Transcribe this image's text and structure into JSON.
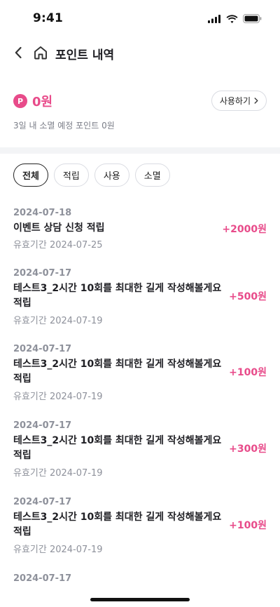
{
  "status_bar": {
    "time": "9:41"
  },
  "header": {
    "title": "포인트 내역"
  },
  "summary": {
    "badge": "P",
    "value": "0원",
    "use_button": "사용하기",
    "expire_note": "3일 내 소멸 예정 포인트 0원"
  },
  "filters": [
    {
      "label": "전체",
      "active": true
    },
    {
      "label": "적립",
      "active": false
    },
    {
      "label": "사용",
      "active": false
    },
    {
      "label": "소멸",
      "active": false
    }
  ],
  "history": [
    {
      "date": "2024-07-18",
      "title": "이벤트 상담 신청 적립",
      "expiry": "유효기간 2024-07-25",
      "amount": "+2000원"
    },
    {
      "date": "2024-07-17",
      "title": "테스트3_2시간 10회를 최대한 길게 작성해볼게요 적립",
      "expiry": "유효기간 2024-07-19",
      "amount": "+500원"
    },
    {
      "date": "2024-07-17",
      "title": "테스트3_2시간 10회를 최대한 길게 작성해볼게요 적립",
      "expiry": "유효기간 2024-07-19",
      "amount": "+100원"
    },
    {
      "date": "2024-07-17",
      "title": "테스트3_2시간 10회를 최대한 길게 작성해볼게요 적립",
      "expiry": "유효기간 2024-07-19",
      "amount": "+300원"
    },
    {
      "date": "2024-07-17",
      "title": "테스트3_2시간 10회를 최대한 길게 작성해볼게요 적립",
      "expiry": "유효기간 2024-07-19",
      "amount": "+100원"
    },
    {
      "date": "2024-07-17",
      "title": "",
      "expiry": "",
      "amount": ""
    }
  ],
  "colors": {
    "accent": "#e84b8a",
    "muted": "#8e919b",
    "divider": "#f3f4f6"
  }
}
